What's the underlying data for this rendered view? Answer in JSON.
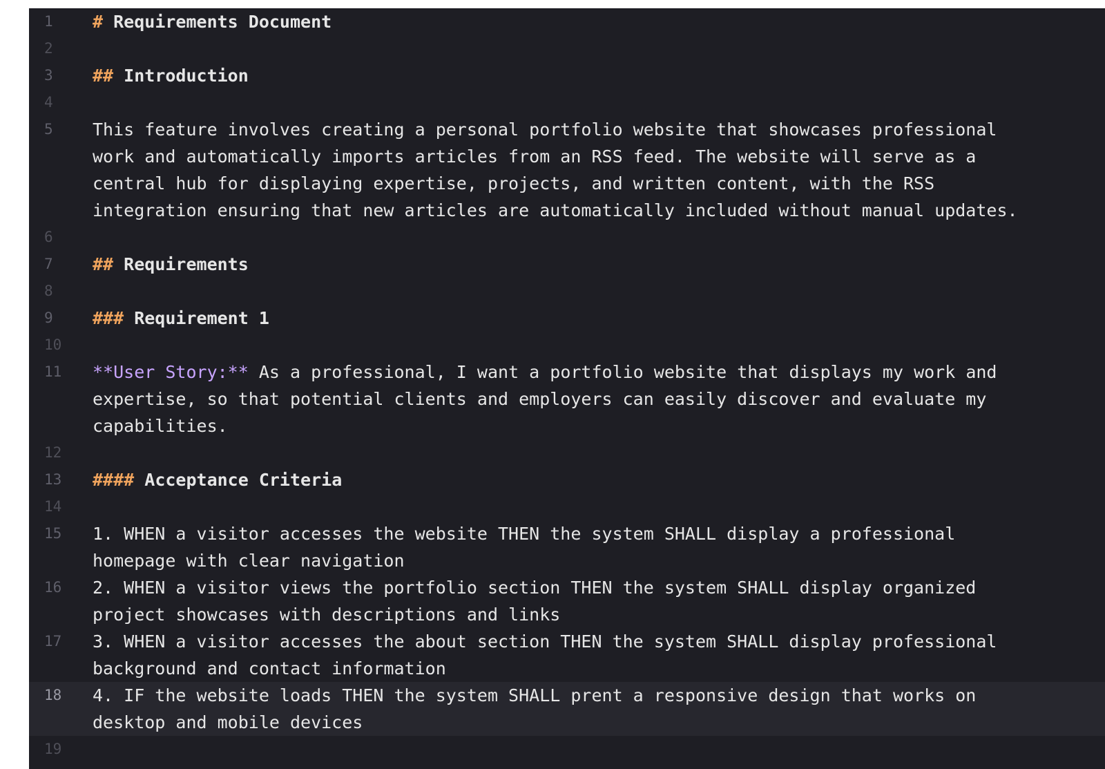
{
  "editor": {
    "lines": [
      {
        "n": "1",
        "marker": "#",
        "text": " Requirements Document"
      },
      {
        "n": "2"
      },
      {
        "n": "3",
        "marker": "##",
        "text": " Introduction"
      },
      {
        "n": "4"
      },
      {
        "n": "5",
        "wrap": [
          "This feature involves creating a personal portfolio website that showcases professional",
          "work and automatically imports articles from an RSS feed. The website will serve as a",
          "central hub for displaying expertise, projects, and written content, with the RSS",
          "integration ensuring that new articles are automatically included without manual updates."
        ]
      },
      {
        "n": "6"
      },
      {
        "n": "7",
        "marker": "##",
        "text": " Requirements"
      },
      {
        "n": "8"
      },
      {
        "n": "9",
        "marker": "###",
        "text": " Requirement 1"
      },
      {
        "n": "10"
      },
      {
        "n": "11",
        "emph": "**User Story:**",
        "wrap": [
          " As a professional, I want a portfolio website that displays my work and",
          "expertise, so that potential clients and employers can easily discover and evaluate my",
          "capabilities."
        ]
      },
      {
        "n": "12"
      },
      {
        "n": "13",
        "marker": "####",
        "text": " Acceptance Criteria"
      },
      {
        "n": "14"
      },
      {
        "n": "15",
        "wrap": [
          "1. WHEN a visitor accesses the website THEN the system SHALL display a professional",
          "homepage with clear navigation"
        ]
      },
      {
        "n": "16",
        "wrap": [
          "2. WHEN a visitor views the portfolio section THEN the system SHALL display organized",
          "project showcases with descriptions and links"
        ]
      },
      {
        "n": "17",
        "wrap": [
          "3. WHEN a visitor accesses the about section THEN the system SHALL display professional",
          "background and contact information"
        ]
      },
      {
        "n": "18",
        "active": true,
        "wrap": [
          "4. IF the website loads THEN the system SHALL prent a responsive design that works on",
          "desktop and mobile devices"
        ]
      },
      {
        "n": "19"
      }
    ]
  },
  "colors": {
    "background": "#1e1e24",
    "heading_marker": "#f0a45d",
    "emphasis": "#c8a4ff",
    "text": "#e6e6e6",
    "line_number": "#5f5f6a"
  }
}
